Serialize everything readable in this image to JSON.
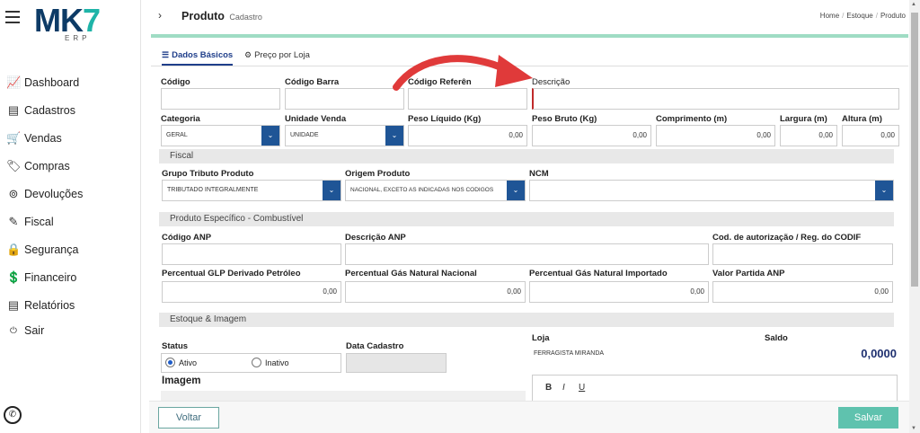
{
  "logo": {
    "main": "MK",
    "accent": "7",
    "sub": "ERP"
  },
  "sidebar": {
    "items": [
      {
        "label": "Dashboard",
        "icon": "chart-icon"
      },
      {
        "label": "Cadastros",
        "icon": "document-icon"
      },
      {
        "label": "Vendas",
        "icon": "cart-icon"
      },
      {
        "label": "Compras",
        "icon": "tag-icon"
      },
      {
        "label": "Devoluções",
        "icon": "return-icon"
      },
      {
        "label": "Fiscal",
        "icon": "pen-icon"
      },
      {
        "label": "Segurança",
        "icon": "lock-icon"
      },
      {
        "label": "Financeiro",
        "icon": "money-icon"
      },
      {
        "label": "Relatórios",
        "icon": "report-icon"
      },
      {
        "label": "Sair",
        "icon": "power-icon"
      }
    ]
  },
  "header": {
    "title": "Produto",
    "subtitle": "Cadastro",
    "breadcrumb": [
      "Home",
      "Estoque",
      "Produto"
    ]
  },
  "tabs": [
    {
      "label": "Dados Básicos",
      "active": true
    },
    {
      "label": "Preço por Loja",
      "active": false
    }
  ],
  "form": {
    "codigo": "Código",
    "codigo_barra": "Código Barra",
    "codigo_referencia": "Código Referên",
    "descricao": "Descrição",
    "categoria": "Categoria",
    "categoria_value": "GERAL",
    "unidade_venda": "Unidade Venda",
    "unidade_value": "UNIDADE",
    "peso_liquido": "Peso Líquido (Kg)",
    "peso_liquido_value": "0,00",
    "peso_bruto": "Peso Bruto (Kg)",
    "peso_bruto_value": "0,00",
    "comprimento": "Comprimento (m)",
    "comprimento_value": "0,00",
    "largura": "Largura (m)",
    "largura_value": "0,00",
    "altura": "Altura (m)",
    "altura_value": "0,00"
  },
  "fiscal": {
    "section": "Fiscal",
    "grupo_tributo": "Grupo Tributo Produto",
    "grupo_tributo_value": "TRIBUTADO INTEGRALMENTE",
    "origem": "Origem Produto",
    "origem_value": "NACIONAL, EXCETO AS INDICADAS NOS CODIGOS",
    "ncm": "NCM"
  },
  "combustivel": {
    "section": "Produto Específico - Combustível",
    "codigo_anp": "Código ANP",
    "descricao_anp": "Descrição ANP",
    "cod_autorizacao": "Cod. de autorização / Reg. do CODIF",
    "perc_glp": "Percentual GLP Derivado Petróleo",
    "perc_glp_value": "0,00",
    "perc_gn_nacional": "Percentual Gás Natural Nacional",
    "perc_gn_nacional_value": "0,00",
    "perc_gn_importado": "Percentual Gás Natural Importado",
    "perc_gn_importado_value": "0,00",
    "valor_partida": "Valor Partida ANP",
    "valor_partida_value": "0,00"
  },
  "estoque": {
    "section": "Estoque & Imagem",
    "status": "Status",
    "ativo": "Ativo",
    "inativo": "Inativo",
    "data_cadastro": "Data Cadastro",
    "imagem": "Imagem",
    "loja": "Loja",
    "saldo": "Saldo",
    "loja_name": "FERRAGISTA MIRANDA",
    "saldo_value": "0,0000",
    "editor_tools": [
      "B",
      "I",
      "U"
    ]
  },
  "footer": {
    "voltar": "Voltar",
    "salvar": "Salvar"
  },
  "colors": {
    "primary": "#1f5596",
    "accent": "#5fc2ae",
    "arrow": "#e03a3a"
  }
}
